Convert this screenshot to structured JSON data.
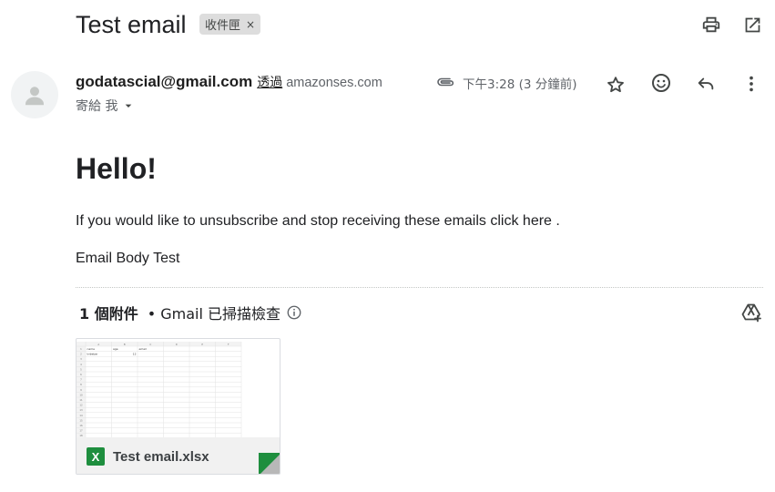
{
  "email": {
    "subject": "Test email",
    "label": "收件匣",
    "label_remove": "×"
  },
  "toolbar": {
    "print_icon": "print-icon",
    "popout_icon": "open-in-new-window-icon"
  },
  "sender": {
    "avatar_icon": "person-icon",
    "email": "godatascial@gmail.com",
    "via_label": "透過",
    "via_domain": "amazonses.com",
    "to_label": "寄給 我",
    "timestamp": "下午3:28 (3 分鐘前)"
  },
  "actions": {
    "attachment_icon": "paperclip-icon",
    "star_icon": "star-icon",
    "emoji_icon": "emoji-reaction-icon",
    "reply_icon": "reply-icon",
    "more_icon": "more-vertical-icon"
  },
  "body": {
    "greeting": "Hello!",
    "unsubscribe_text": "If you would like to unsubscribe and stop receiving these emails click here .",
    "body_text": "Email Body Test"
  },
  "attachments": {
    "count_label": "1 個附件",
    "scan_label": "• Gmail 已掃描檢查",
    "info_icon": "info-icon",
    "drive_icon": "add-to-drive-icon",
    "file": {
      "name": "Test email.xlsx",
      "type_icon": "excel-icon",
      "type_letter": "X",
      "preview": {
        "columns": [
          "A",
          "B",
          "C",
          "D",
          "E",
          "F"
        ],
        "header_row": [
          "name",
          "age",
          "email"
        ],
        "data_row": [
          "tribebar",
          "12",
          ""
        ],
        "row_numbers": [
          "1",
          "2",
          "3",
          "4",
          "5",
          "6",
          "7",
          "8",
          "9",
          "10",
          "11",
          "12",
          "13",
          "14",
          "15",
          "16",
          "17",
          "18"
        ]
      }
    }
  },
  "colors": {
    "accent_green": "#1e8e3e",
    "chip_bg": "#dddddd",
    "text_primary": "#202124",
    "text_secondary": "#5f6368"
  }
}
